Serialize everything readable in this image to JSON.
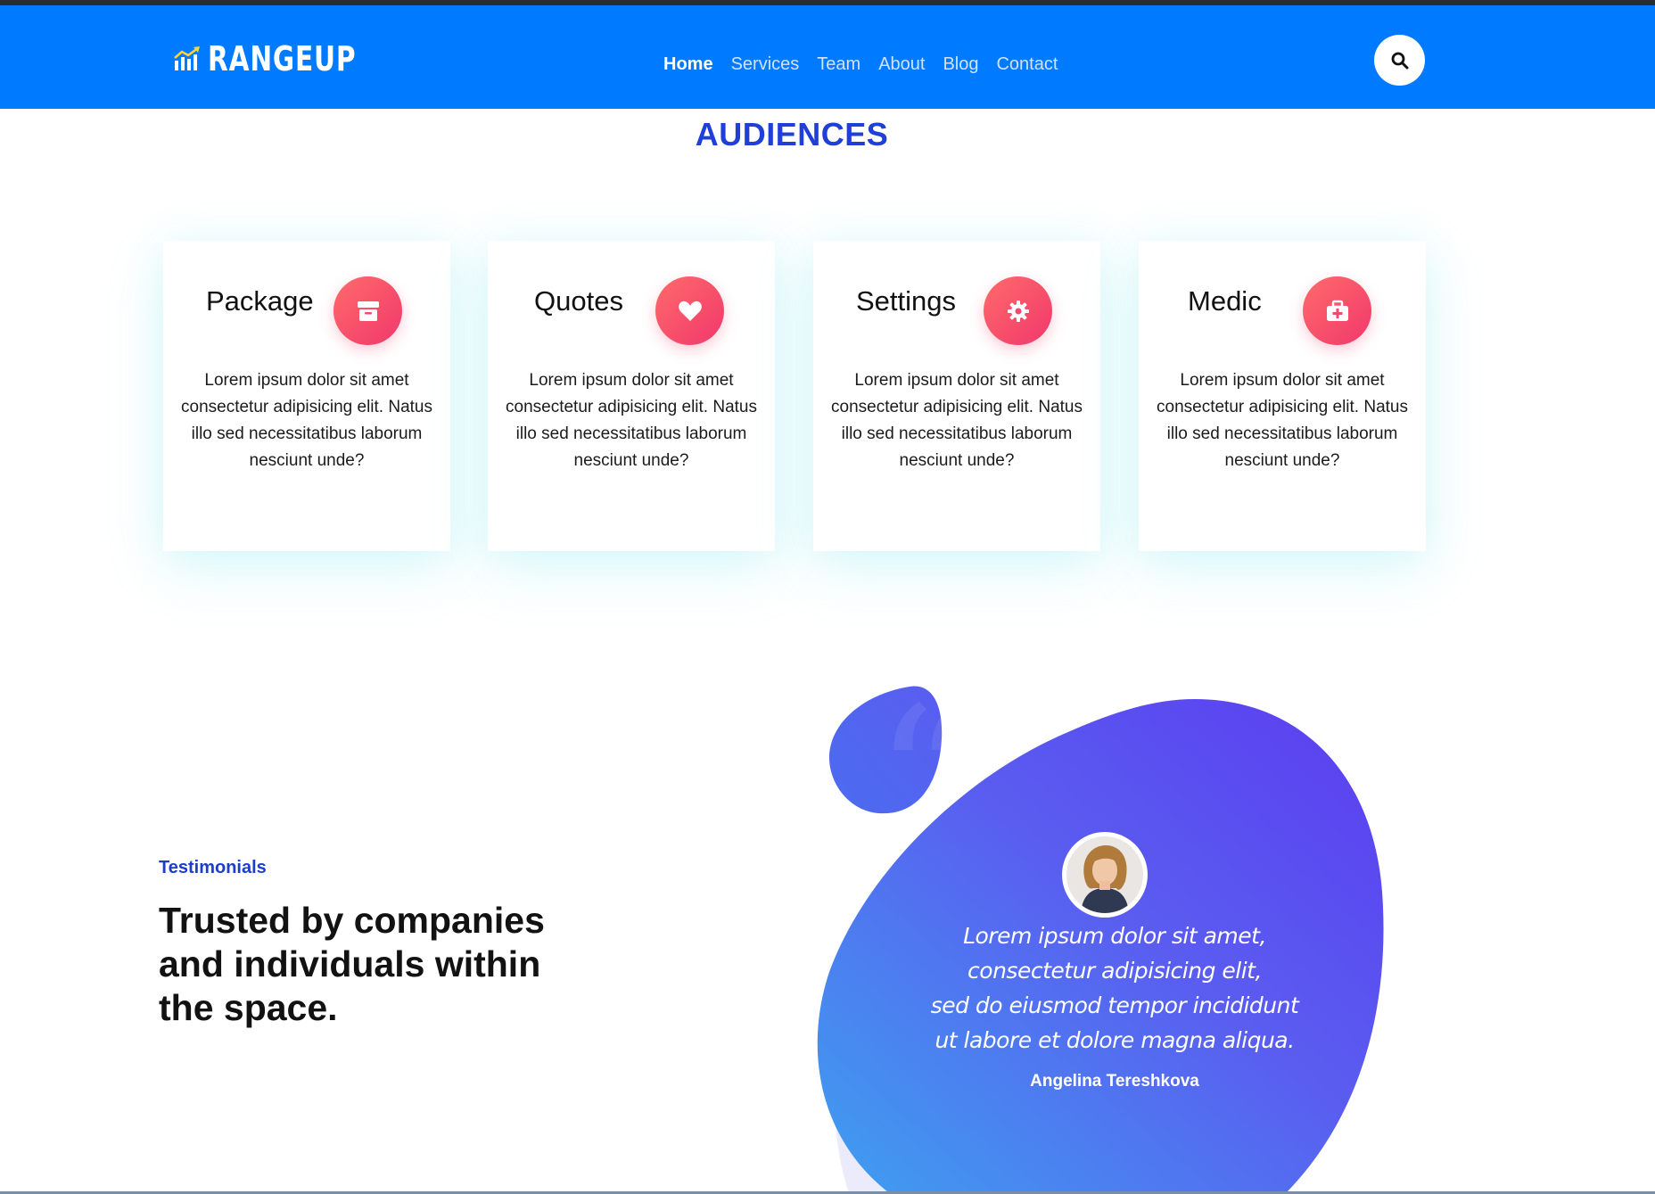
{
  "colors": {
    "header_bg": "#007bff",
    "accent_title": "#1f3fd8",
    "icon_gradient_start": "#ff6b6b",
    "icon_gradient_end": "#f0386b",
    "blob_gradient_start": "#3ea0f0",
    "blob_gradient_end": "#5b3df0"
  },
  "header": {
    "logo_text": "RANGEUP",
    "logo_icon": "bar-chart-arrow-icon",
    "nav": [
      {
        "label": "Home",
        "active": true
      },
      {
        "label": "Services",
        "active": false
      },
      {
        "label": "Team",
        "active": false
      },
      {
        "label": "About",
        "active": false
      },
      {
        "label": "Blog",
        "active": false
      },
      {
        "label": "Contact",
        "active": false
      }
    ],
    "search_icon": "search-icon"
  },
  "audiences": {
    "title": "AUDIENCES",
    "cards": [
      {
        "title": "Package",
        "icon": "box-icon",
        "text": "Lorem ipsum dolor sit amet consectetur adipisicing elit. Natus illo sed necessitatibus laborum nesciunt unde?"
      },
      {
        "title": "Quotes",
        "icon": "heart-icon",
        "text": "Lorem ipsum dolor sit amet consectetur adipisicing elit. Natus illo sed necessitatibus laborum nesciunt unde?"
      },
      {
        "title": "Settings",
        "icon": "gear-icon",
        "text": "Lorem ipsum dolor sit amet consectetur adipisicing elit. Natus illo sed necessitatibus laborum nesciunt unde?"
      },
      {
        "title": "Medic",
        "icon": "medical-kit-icon",
        "text": "Lorem ipsum dolor sit amet consectetur adipisicing elit. Natus illo sed necessitatibus laborum nesciunt unde?"
      }
    ]
  },
  "testimonials": {
    "label": "Testimonials",
    "heading": "Trusted by companies and individuals within the space.",
    "quote_lines": [
      "Lorem ipsum dolor sit amet,",
      "consectetur adipisicing elit,",
      "sed do eiusmod tempor incididunt",
      "ut labore et dolore magna aliqua."
    ],
    "author": "Angelina Tereshkova",
    "avatar_icon": "person-avatar-icon"
  }
}
